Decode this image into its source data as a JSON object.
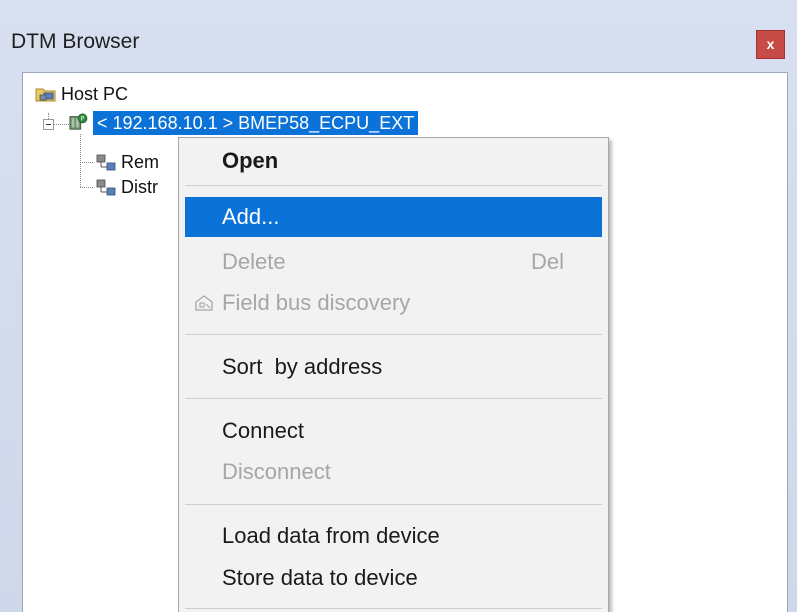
{
  "window": {
    "title": "DTM Browser",
    "close_label": "x"
  },
  "tree": {
    "root": {
      "label": "Host PC",
      "icon": "host-pc-folder-icon"
    },
    "device": {
      "label": "< 192.168.10.1 > BMEP58_ECPU_EXT",
      "icon": "plc-device-icon",
      "selected": true
    },
    "children": [
      {
        "label": "Rem",
        "icon": "network-node-icon"
      },
      {
        "label": "Distr",
        "icon": "network-node-icon"
      }
    ]
  },
  "context_menu": {
    "items": [
      {
        "label": "Open",
        "bold": true,
        "disabled": false
      },
      {
        "label": "Add...",
        "highlighted": true,
        "disabled": false
      },
      {
        "label": "Delete",
        "shortcut": "Del",
        "disabled": true
      },
      {
        "label": "Field bus discovery",
        "icon": "field-bus-discovery-icon",
        "disabled": true
      },
      {
        "label": "Sort  by address",
        "disabled": false
      },
      {
        "label": "Connect",
        "disabled": false
      },
      {
        "label": "Disconnect",
        "disabled": true
      },
      {
        "label": "Load data from device",
        "disabled": false
      },
      {
        "label": "Store data to device",
        "disabled": false
      }
    ]
  },
  "colors": {
    "selection": "#0b72d7",
    "close_button": "#c74b46",
    "menu_background": "#f2f2f2",
    "disabled_text": "#a6a6a6"
  }
}
